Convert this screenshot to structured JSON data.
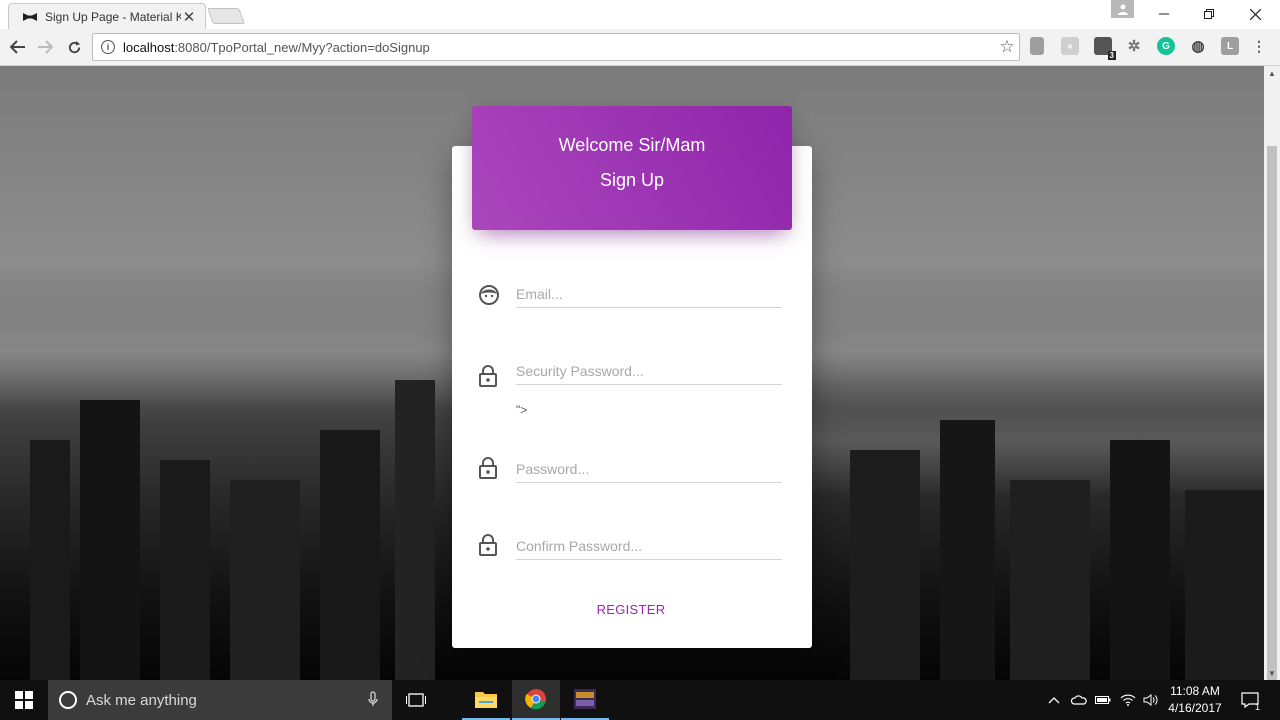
{
  "browser": {
    "tab_title": "Sign Up Page - Material K",
    "url_host": "localhost",
    "url_rest": ":8080/TpoPortal_new/Myy?action=doSignup",
    "extension_badge": "3",
    "extension_letter": "L"
  },
  "page": {
    "header": {
      "welcome": "Welcome Sir/Mam",
      "subtitle": "Sign Up"
    },
    "fields": {
      "email_placeholder": "Email...",
      "security_placeholder": "Security Password...",
      "password_placeholder": "Password...",
      "confirm_placeholder": "Confirm Password..."
    },
    "stray_text": "\">",
    "register_label": "REGISTER"
  },
  "taskbar": {
    "search_text": "Ask me anything",
    "time": "11:08 AM",
    "date": "4/16/2017",
    "notification_count": "1"
  },
  "colors": {
    "accent": "#9c27b0",
    "header_gradient_start": "#ab47bc",
    "header_gradient_end": "#8e24aa"
  }
}
